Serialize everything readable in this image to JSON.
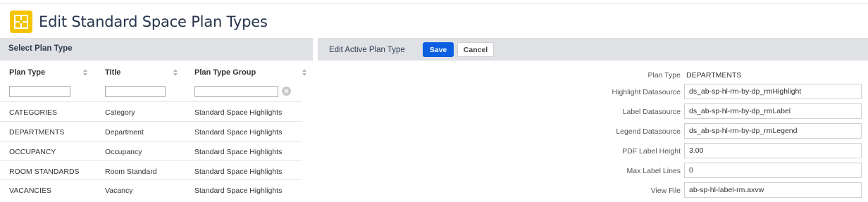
{
  "page": {
    "title": "Edit Standard Space Plan Types"
  },
  "left_panel": {
    "header": "Select Plan Type",
    "columns": [
      "Plan Type",
      "Title",
      "Plan Type Group"
    ],
    "filters": [
      "",
      "",
      ""
    ],
    "rows": [
      [
        "CATEGORIES",
        "Category",
        "Standard Space Highlights"
      ],
      [
        "DEPARTMENTS",
        "Department",
        "Standard Space Highlights"
      ],
      [
        "OCCUPANCY",
        "Occupancy",
        "Standard Space Highlights"
      ],
      [
        "ROOM STANDARDS",
        "Room Standard",
        "Standard Space Highlights"
      ],
      [
        "VACANCIES",
        "Vacancy",
        "Standard Space Highlights"
      ]
    ]
  },
  "right_panel": {
    "header": "Edit Active Plan Type",
    "save_label": "Save",
    "cancel_label": "Cancel",
    "fields": [
      {
        "label": "Plan Type",
        "value": "DEPARTMENTS"
      },
      {
        "label": "Highlight Datasource",
        "value": "ds_ab-sp-hl-rm-by-dp_rmHighlight"
      },
      {
        "label": "Label Datasource",
        "value": "ds_ab-sp-hl-rm-by-dp_rmLabel"
      },
      {
        "label": "Legend Datasource",
        "value": "ds_ab-sp-hl-rm-by-dp_rmLegend"
      },
      {
        "label": "PDF Label Height",
        "value": "3.00"
      },
      {
        "label": "Max Label Lines",
        "value": "0"
      },
      {
        "label": "View File",
        "value": "ab-sp-hl-label-rm.axvw"
      }
    ]
  },
  "colors": {
    "accent": "#0b5fe0",
    "icon_bg": "#f5c400",
    "title": "#27364d",
    "panel_header": "#dfe1e5"
  },
  "icons": {
    "app": "floor-plan-icon",
    "sort": "sort-icon",
    "clear": "clear-filter-icon"
  }
}
